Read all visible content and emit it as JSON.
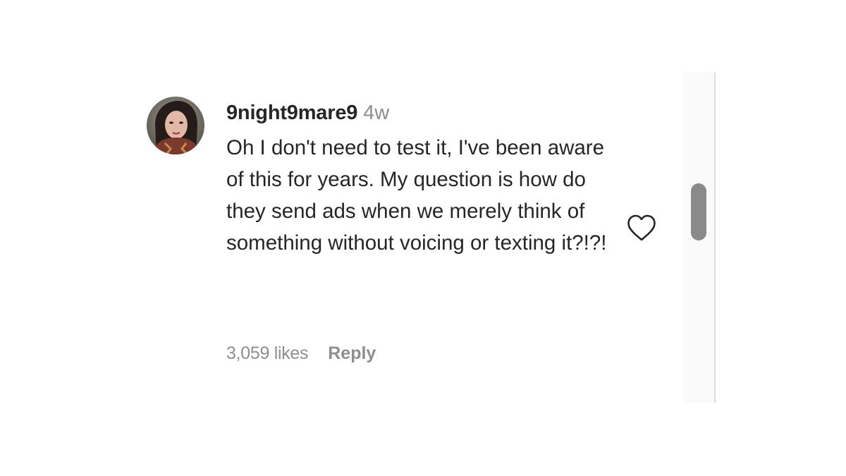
{
  "comment": {
    "username": "9night9mare9",
    "timestamp": "4w",
    "text": "Oh I don't need to test it, I've been aware of this for years. My question is how do they send ads when we merely think of something without voicing or texting it?!?!",
    "likes": "3,059 likes",
    "reply_label": "Reply",
    "like_icon": "heart-outline-icon"
  },
  "colors": {
    "primary_text": "#262626",
    "secondary_text": "#8e8e8e",
    "scroll_thumb": "#8a8a8a"
  }
}
